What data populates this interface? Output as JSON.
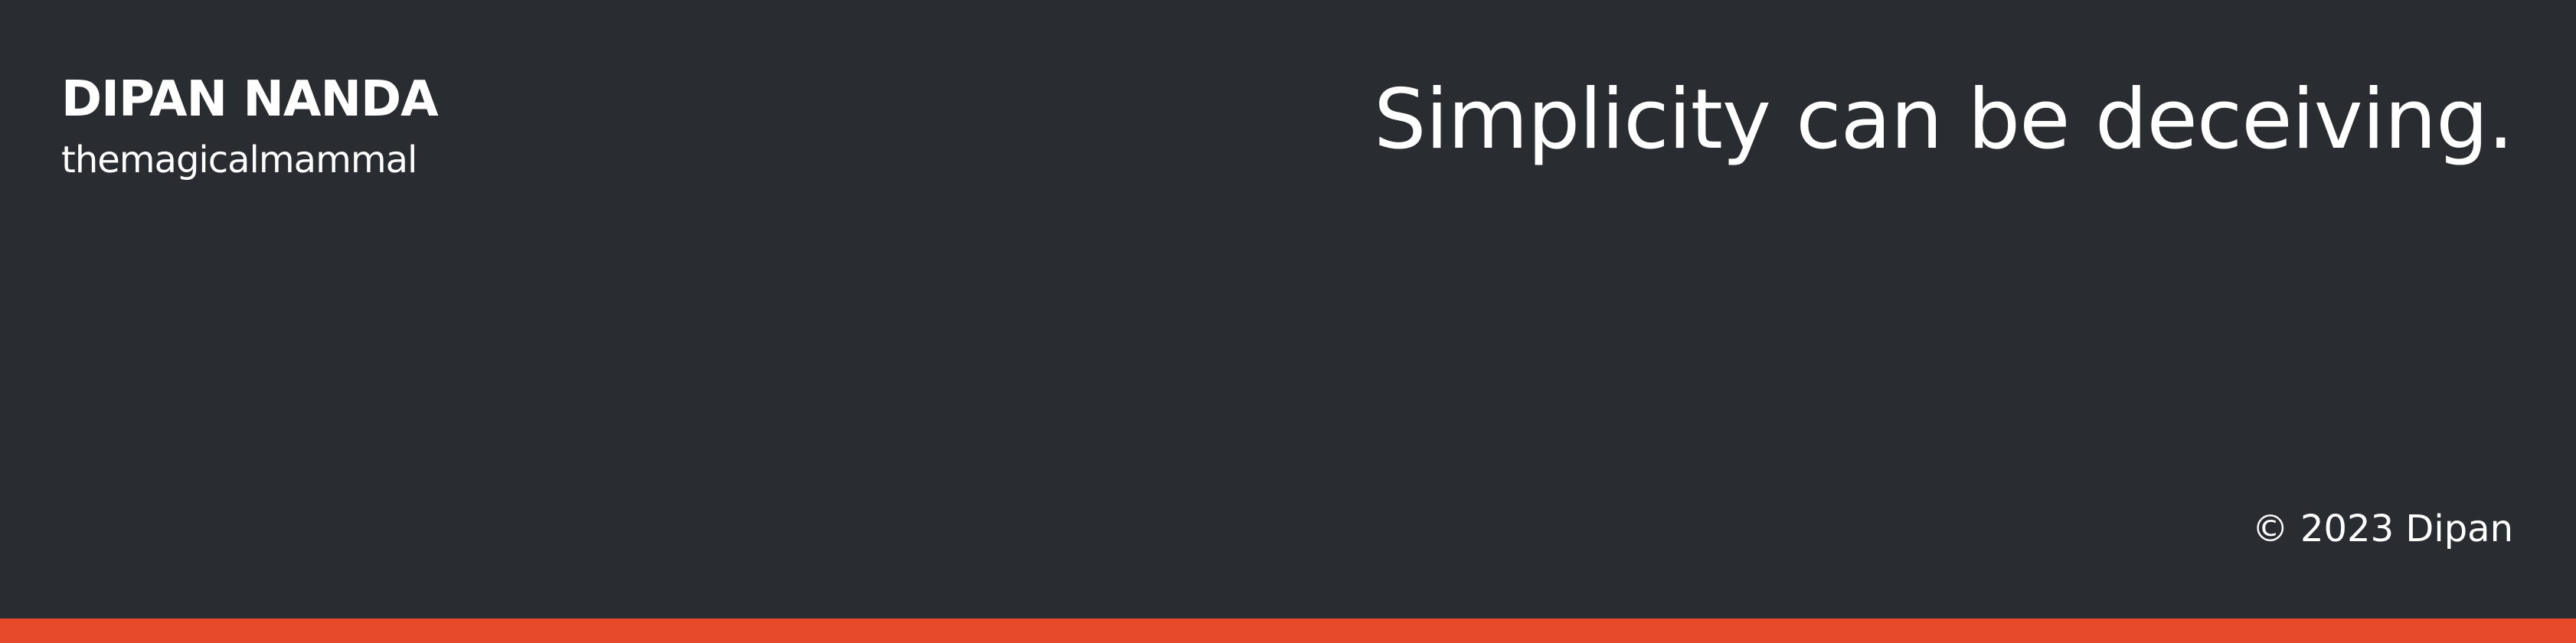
{
  "header": {
    "name": "DIPAN NANDA",
    "handle": "themagicalmammal"
  },
  "hero": {
    "tagline": "Simplicity can be deceiving."
  },
  "footer": {
    "copyright": "© 2023 Dipan"
  },
  "colors": {
    "background": "#292c31",
    "text": "#ffffff",
    "accent": "#e64a2b"
  }
}
